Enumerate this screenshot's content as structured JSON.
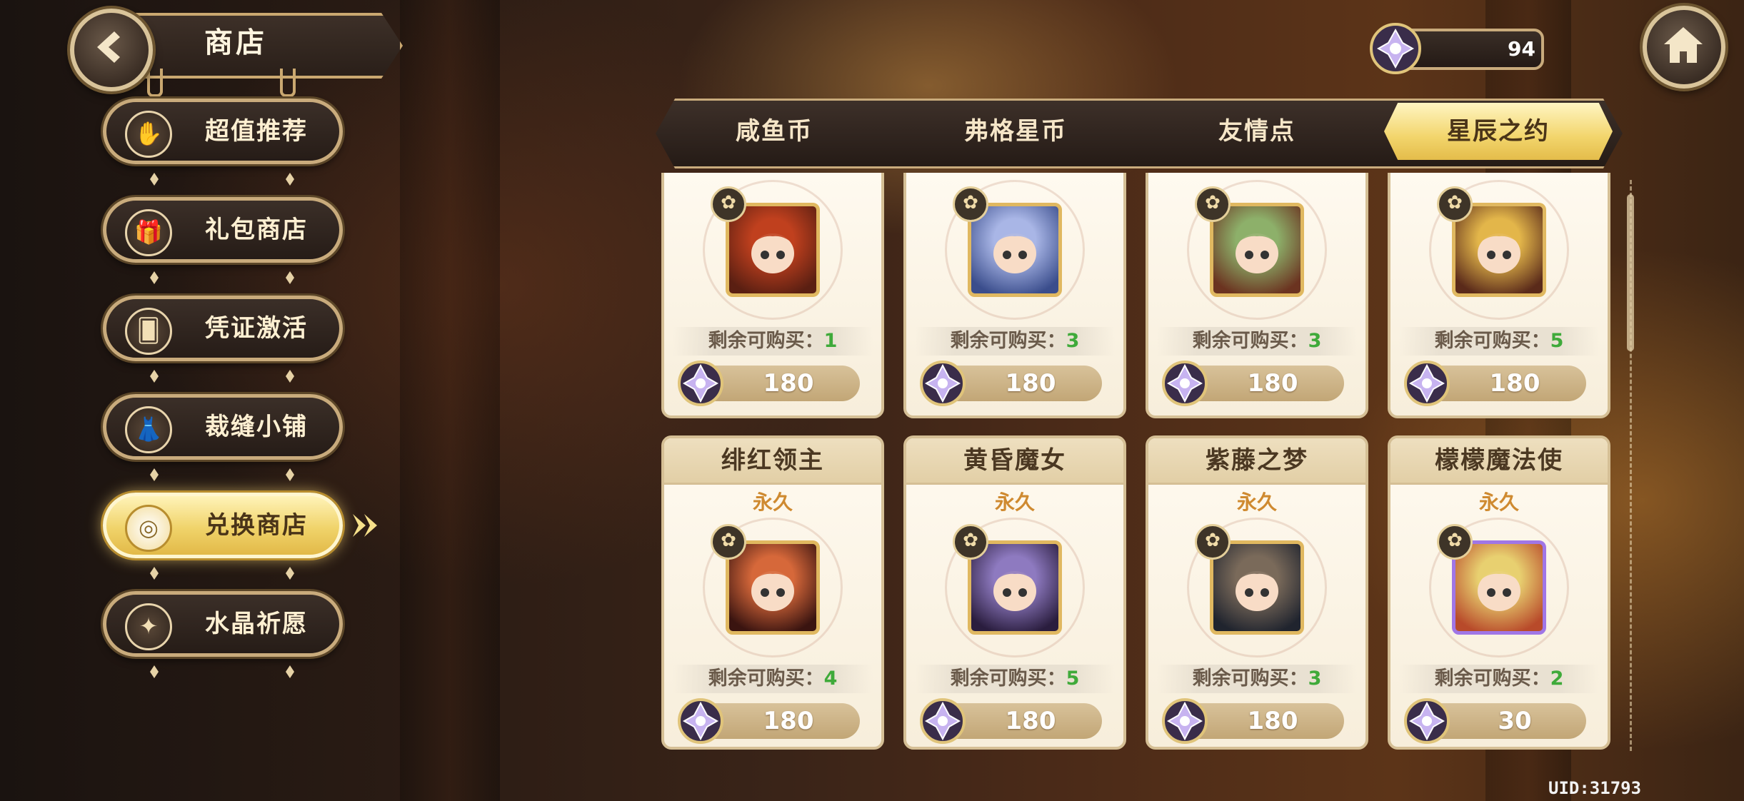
{
  "header": {
    "title": "商店"
  },
  "currency": {
    "amount": "94",
    "icon": "star-crystal-icon"
  },
  "sidebar": {
    "items": [
      {
        "label": "超值推荐",
        "icon": "hand-coin-icon",
        "glyph": "✋"
      },
      {
        "label": "礼包商店",
        "icon": "gift-icon",
        "glyph": "🎁"
      },
      {
        "label": "凭证激活",
        "icon": "card-icon",
        "glyph": "🂠"
      },
      {
        "label": "裁缝小铺",
        "icon": "dress-icon",
        "glyph": "👗"
      },
      {
        "label": "兑换商店",
        "icon": "coin-exchange-icon",
        "glyph": "◎"
      },
      {
        "label": "水晶祈愿",
        "icon": "crystal-icon",
        "glyph": "✦"
      }
    ],
    "active_index": 4
  },
  "tabs": {
    "items": [
      "咸鱼币",
      "弗格星币",
      "友情点",
      "星辰之约"
    ],
    "active_index": 3
  },
  "grid": {
    "remain_label": "剩余可购买：",
    "rows": [
      [
        {
          "remain": "1",
          "price": "180",
          "frame": "gold",
          "colors": [
            "#c0401e",
            "#5a1f12"
          ]
        },
        {
          "remain": "3",
          "price": "180",
          "frame": "gold",
          "colors": [
            "#a9b6e6",
            "#3a4d8c"
          ]
        },
        {
          "remain": "3",
          "price": "180",
          "frame": "gold",
          "colors": [
            "#8db06a",
            "#6b3320"
          ]
        },
        {
          "remain": "5",
          "price": "180",
          "frame": "gold",
          "colors": [
            "#e3b64a",
            "#5a2a1a"
          ]
        }
      ],
      [
        {
          "name": "绯红领主",
          "duration": "永久",
          "remain": "4",
          "price": "180",
          "frame": "gold",
          "colors": [
            "#d6683a",
            "#3a1410"
          ]
        },
        {
          "name": "黄昏魔女",
          "duration": "永久",
          "remain": "5",
          "price": "180",
          "frame": "gold",
          "colors": [
            "#8e7ac0",
            "#2a1d3e"
          ]
        },
        {
          "name": "紫藤之梦",
          "duration": "永久",
          "remain": "3",
          "price": "180",
          "frame": "gold",
          "colors": [
            "#7a6a5a",
            "#20242e"
          ]
        },
        {
          "name": "檬檬魔法使",
          "duration": "永久",
          "remain": "2",
          "price": "30",
          "frame": "purple",
          "colors": [
            "#e8d070",
            "#b84a2a"
          ]
        }
      ]
    ]
  },
  "footer": {
    "uid": "UID:31793"
  }
}
